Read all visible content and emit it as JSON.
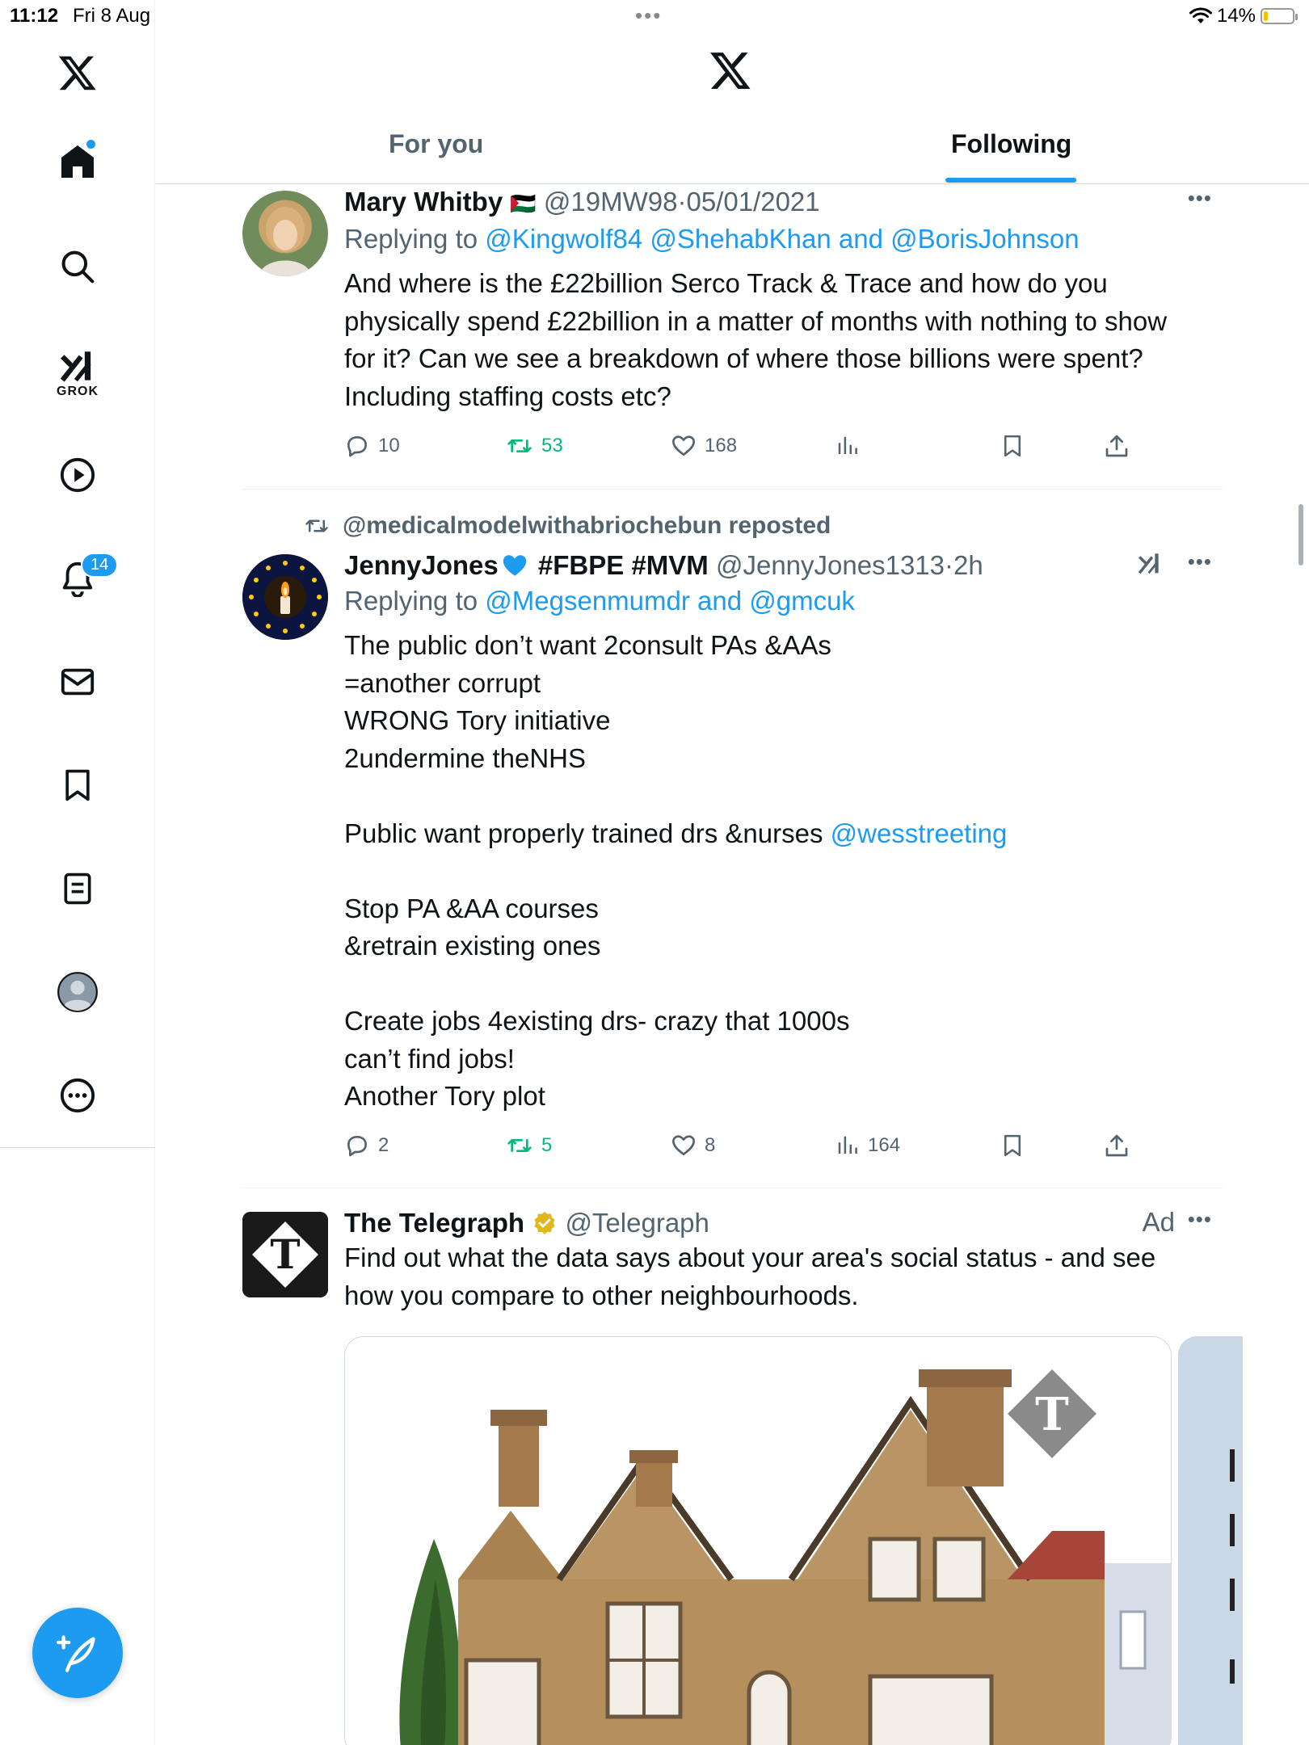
{
  "status_bar": {
    "time": "11:12",
    "date": "Fri 8 Aug",
    "battery": "14%",
    "battery_level": 0.14
  },
  "sidebar": {
    "grok_label": "GROK",
    "notifications_count": "14"
  },
  "header": {
    "tabs": [
      {
        "label": "For you",
        "selected": false
      },
      {
        "label": "Following",
        "selected": true
      }
    ]
  },
  "tweets": [
    {
      "name": "Mary Whitby",
      "flag": "🇵🇸",
      "handle": "@19MW98",
      "separator": "·",
      "time": "05/01/2021",
      "replying_prefix": "Replying to ",
      "replying_to": "@Kingwolf84 @ShehabKhan and @BorisJohnson",
      "text": "And where is the £22billion Serco Track & Trace and how do you\nphysically spend £22billion in a matter of months with nothing to show\nfor it? Can we see a breakdown of where those billions were spent?\nIncluding staffing costs etc?",
      "replies": "10",
      "reposts": "53",
      "likes": "168",
      "views": ""
    },
    {
      "reposted_by": "@medicalmodelwithabriochebun reposted",
      "name": "JennyJones",
      "name_suffix": "#FBPE #MVM",
      "handle": "@JennyJones1313",
      "separator": "·",
      "time": "2h",
      "replying_prefix": "Replying to ",
      "replying_to": "@Megsenmumdr and @gmcuk",
      "text_1": "The public don’t want 2consult PAs &AAs\n=another corrupt\nWRONG Tory initiative\n2undermine theNHS\n\nPublic want properly trained drs &nurses ",
      "text_link": "@wesstreeting",
      "text_2": "\n\nStop PA &AA courses\n&retrain existing ones\n\nCreate jobs 4existing drs- crazy that 1000s\ncan’t find jobs!\nAnother Tory plot",
      "replies": "2",
      "reposts": "5",
      "likes": "8",
      "views": "164"
    },
    {
      "name": "The Telegraph",
      "handle": "@Telegraph",
      "ad_label": "Ad",
      "text": "Find out what the data says about your area's social status - and see\nhow you compare to other neighbourhoods."
    }
  ],
  "colors": {
    "accent": "#1d9bf0",
    "repost_green": "#00ba7c",
    "secondary_text": "#536471"
  }
}
